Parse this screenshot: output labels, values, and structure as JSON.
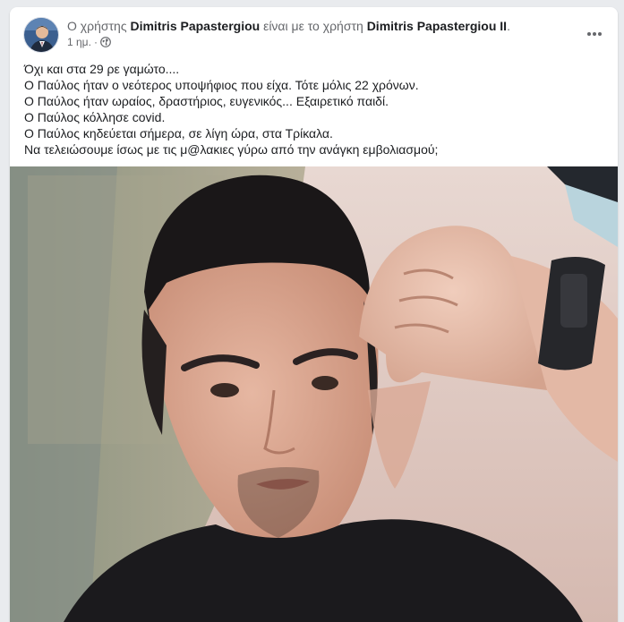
{
  "post": {
    "header": {
      "prefix": "Ο χρήστης",
      "author": "Dimitris Papastergiou",
      "connector": "είναι με το χρήστη",
      "tagged": "Dimitris Papastergiou II",
      "suffix": "."
    },
    "meta": {
      "time": "1 ημ.",
      "separator": "·",
      "audience_icon": "globe-icon"
    },
    "menu_icon": "more-options-icon",
    "text_lines": [
      "Όχι και στα 29 ρε γαμώτο....",
      "Ο Παύλος ήταν ο νεότερος υποψήφιος που είχα. Τότε μόλις 22 χρόνων.",
      "Ο Παύλος ήταν ωραίος, δραστήριος, ευγενικός... Εξαιρετικό παιδί.",
      "Ο Παύλος κόλλησε covid.",
      "Ο Παύλος κηδεύεται σήμερα, σε λίγη ώρα, στα Τρίκαλα.",
      "Να τελειώσουμε ίσως με τις μ@λακιες γύρω από την ανάγκη εμβολιασμού;"
    ],
    "colors": {
      "text": "#1c1e21",
      "secondary_text": "#65676b",
      "background": "#e9ebee",
      "card": "#ffffff"
    }
  }
}
